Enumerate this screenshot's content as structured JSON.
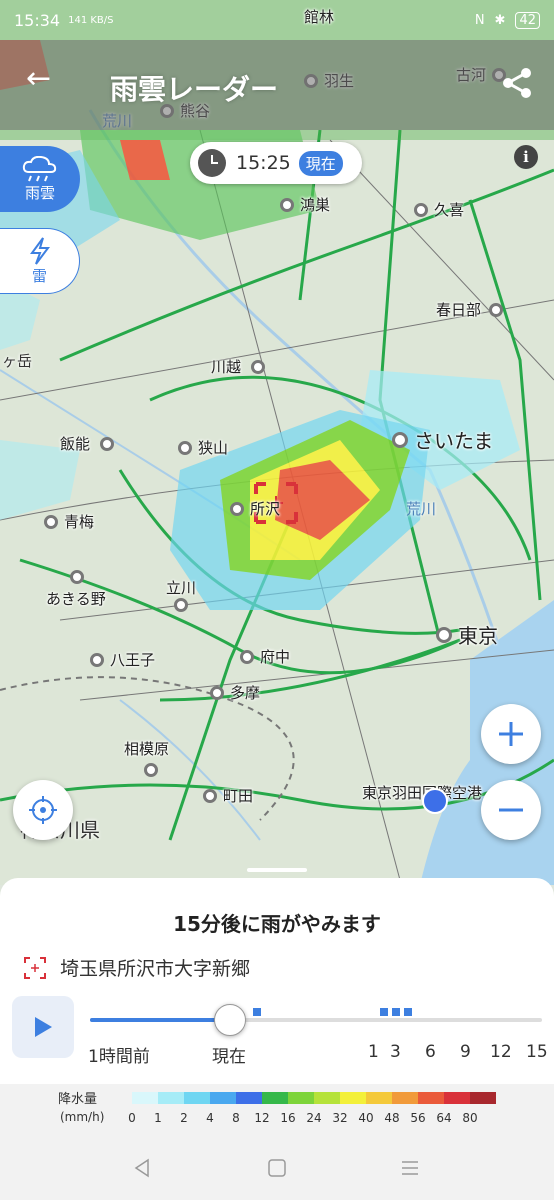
{
  "status_bar": {
    "time": "15:34",
    "net_speed": "141 KB/S",
    "battery": "42"
  },
  "app_bar": {
    "title": "雨雲レーダー",
    "back_icon": "arrow-left-icon",
    "share_icon": "share-icon"
  },
  "time_pill": {
    "time": "15:25",
    "now_label": "現在"
  },
  "layer_buttons": [
    {
      "label": "雨雲",
      "icon": "rain-cloud-icon",
      "active": true
    },
    {
      "label": "雷",
      "icon": "lightning-icon",
      "active": false
    }
  ],
  "map_labels": {
    "cities": [
      "館林",
      "羽生",
      "古河",
      "熊谷",
      "鴻巣",
      "久喜",
      "春日部",
      "川越",
      "飯能",
      "狭山",
      "さいたま",
      "青梅",
      "所沢",
      "立川",
      "あきる野",
      "東京",
      "八王子",
      "府中",
      "多摩",
      "相模原",
      "町田",
      "東京羽田国際空港"
    ],
    "areas": [
      "荒川",
      "荒川",
      "ヶ岳",
      "神奈川県"
    ]
  },
  "panel": {
    "message": "15分後に雨がやみます",
    "location": "埼玉県所沢市大字新郷",
    "timeline_labels": {
      "past": "1時間前",
      "now": "現在",
      "h1": "1",
      "h3": "3",
      "h6": "6",
      "h9": "9",
      "h12": "12",
      "h15": "15"
    }
  },
  "legend": {
    "title": "降水量",
    "unit": "(mm/h)",
    "values": [
      "0",
      "1",
      "2",
      "4",
      "8",
      "12",
      "16",
      "24",
      "32",
      "40",
      "48",
      "56",
      "64",
      "80"
    ],
    "colors": [
      "#d9f7fb",
      "#a6ecf7",
      "#6fd6f2",
      "#4aa8ef",
      "#3d6fe8",
      "#35b84a",
      "#7dd43a",
      "#b5e23a",
      "#f3f03a",
      "#f4c93a",
      "#f19a3a",
      "#ea5a3a",
      "#d9313a",
      "#a8282e"
    ]
  }
}
